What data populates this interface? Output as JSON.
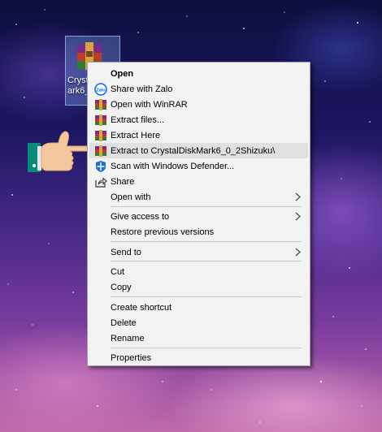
{
  "desktop_icon": {
    "label": "Cryst\nark6_"
  },
  "menu": {
    "items": [
      {
        "label": "Open",
        "icon": "none",
        "bold": true,
        "submenu": false
      },
      {
        "label": "Share with Zalo",
        "icon": "zalo-icon",
        "submenu": false
      },
      {
        "label": "Open with WinRAR",
        "icon": "winrar-icon",
        "submenu": false
      },
      {
        "label": "Extract files...",
        "icon": "winrar-icon",
        "submenu": false
      },
      {
        "label": "Extract Here",
        "icon": "winrar-icon",
        "submenu": false
      },
      {
        "label": "Extract to CrystalDiskMark6_0_2Shizuku\\",
        "icon": "winrar-icon",
        "highlighted": true,
        "submenu": false
      },
      {
        "label": "Scan with Windows Defender...",
        "icon": "windows-defender-icon",
        "submenu": false
      },
      {
        "label": "Share",
        "icon": "share-icon",
        "submenu": false
      },
      {
        "label": "Open with",
        "icon": "none",
        "submenu": true
      },
      {
        "label": "Give access to",
        "icon": "none",
        "submenu": true
      },
      {
        "label": "Restore previous versions",
        "icon": "none",
        "submenu": false
      },
      {
        "label": "Send to",
        "icon": "none",
        "submenu": true
      },
      {
        "label": "Cut",
        "icon": "none",
        "submenu": false
      },
      {
        "label": "Copy",
        "icon": "none",
        "submenu": false
      },
      {
        "label": "Create shortcut",
        "icon": "none",
        "submenu": false
      },
      {
        "label": "Delete",
        "icon": "none",
        "submenu": false
      },
      {
        "label": "Rename",
        "icon": "none",
        "submenu": false
      },
      {
        "label": "Properties",
        "icon": "none",
        "submenu": false
      }
    ]
  },
  "colors": {
    "menu_bg": "#f2f2f2",
    "highlight": "#e0e0e0",
    "zalo_blue": "#0068ff",
    "defender_blue": "#1e73c8"
  }
}
